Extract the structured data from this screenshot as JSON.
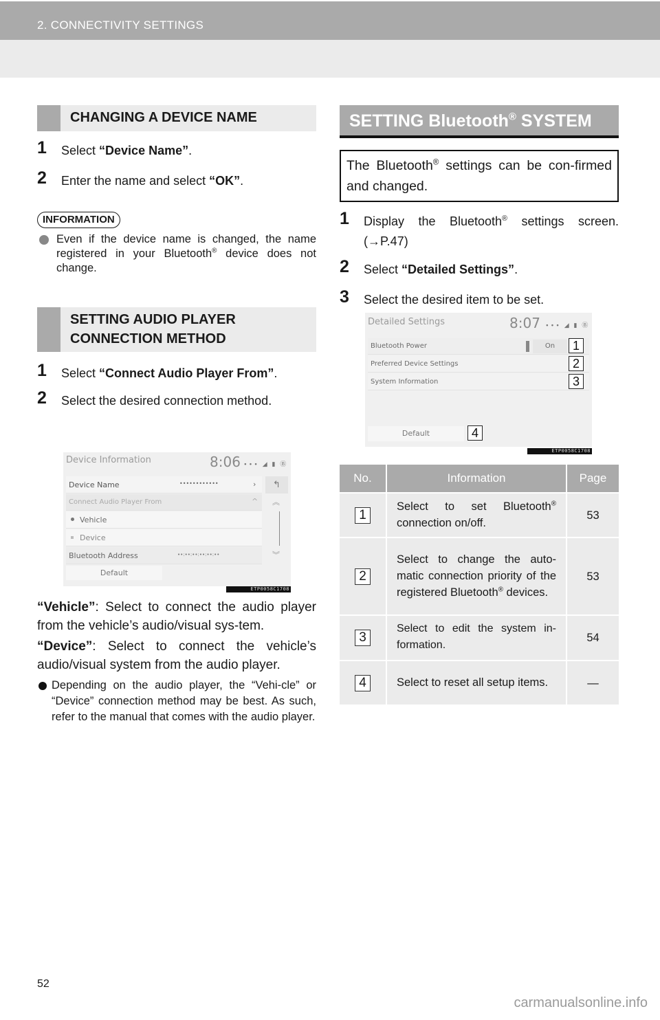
{
  "header": {
    "chapter": "2. CONNECTIVITY SETTINGS"
  },
  "left": {
    "section1": {
      "title": "CHANGING A DEVICE NAME",
      "steps": [
        {
          "num": "1",
          "pre": "Select ",
          "bold": "“Device Name”",
          "post": "."
        },
        {
          "num": "2",
          "pre": "Enter the name and select ",
          "bold": "“OK”",
          "post": "."
        }
      ],
      "info_label": "INFORMATION",
      "info_text_1": "Even if the device name is changed, the name registered in your Bluetooth",
      "info_reg": "®",
      "info_text_2": " device does not change."
    },
    "section2": {
      "title_line1": "SETTING AUDIO PLAYER",
      "title_line2": "CONNECTION METHOD",
      "steps": [
        {
          "num": "1",
          "pre": "Select ",
          "bold": "“Connect Audio Player From”",
          "post": "."
        },
        {
          "num": "2",
          "pre": "Select the desired connection method.",
          "bold": "",
          "post": ""
        }
      ],
      "screen": {
        "title": "Device Information",
        "clock": "8:06",
        "status": "∙∙∙ ◢ ▮ Ⓑ",
        "rows": {
          "device_name": "Device Name",
          "device_name_value": "••••••••••••",
          "connect_from": "Connect Audio Player From",
          "vehicle": "Vehicle",
          "device": "Device",
          "bt_address": "Bluetooth Address",
          "bt_address_value": "••:••:••:••:••:••"
        },
        "default_btn": "Default",
        "code": "ETP0058C1708"
      },
      "vehicle_term": "“Vehicle”",
      "vehicle_desc": ": Select to connect the audio player from the vehicle’s audio/visual sys-tem.",
      "device_term": "“Device”",
      "device_desc": ": Select to connect the vehicle’s audio/visual system from the audio player.",
      "note": "Depending on the audio player, the “Vehi-cle” or “Device” connection method may be best. As such, refer to the manual that comes with the audio player."
    }
  },
  "right": {
    "heading_pre": "SETTING Bluetooth",
    "heading_reg": "®",
    "heading_post": " SYSTEM",
    "intro_pre": "The Bluetooth",
    "intro_reg": "®",
    "intro_post": " settings can be con-firmed and changed.",
    "steps": [
      {
        "num": "1",
        "pre": "Display the Bluetooth",
        "reg": "®",
        "post": " settings screen. (→P.47)"
      },
      {
        "num": "2",
        "pre": "Select ",
        "bold": "“Detailed Settings”",
        "post": "."
      },
      {
        "num": "3",
        "pre": "Select the desired item to be set.",
        "bold": "",
        "post": ""
      }
    ],
    "screen": {
      "title": "Detailed Settings",
      "clock": "8:07",
      "status": "∙∙∙ ◢ ▮ Ⓑ",
      "rows": [
        "Bluetooth Power",
        "Preferred Device Settings",
        "System Information"
      ],
      "power_state": "On",
      "default_btn": "Default",
      "callouts": [
        "1",
        "2",
        "3",
        "4"
      ],
      "code": "ETP0058C1708"
    },
    "table": {
      "headers": [
        "No.",
        "Information",
        "Page"
      ],
      "rows": [
        {
          "no": "1",
          "info_pre": "Select to set Bluetooth",
          "reg": "®",
          "info_post": " connection on/off.",
          "page": "53"
        },
        {
          "no": "2",
          "info_pre": "Select to change the auto-matic connection priority of the registered Bluetooth",
          "reg": "®",
          "info_post": " devices.",
          "page": "53"
        },
        {
          "no": "3",
          "info_pre": "Select to edit the system in-formation.",
          "reg": "",
          "info_post": "",
          "page": "54"
        },
        {
          "no": "4",
          "info_pre": "Select to reset all setup items.",
          "reg": "",
          "info_post": "",
          "page": "—"
        }
      ]
    }
  },
  "footer": {
    "page_number": "52",
    "watermark": "carmanualsonline.info"
  }
}
